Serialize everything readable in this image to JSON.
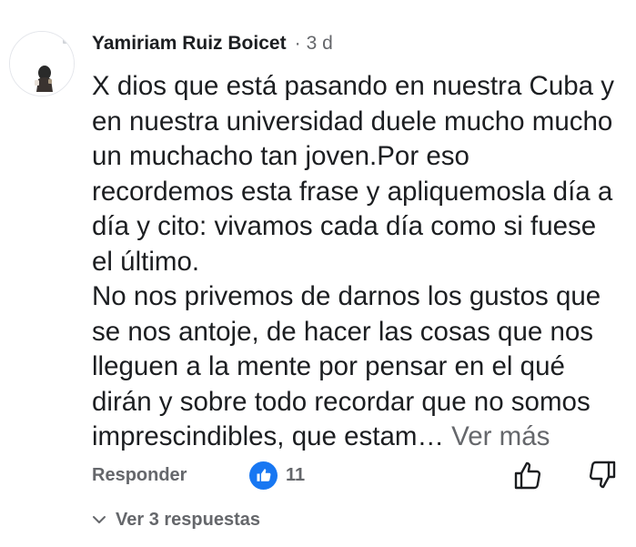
{
  "comment": {
    "author": "Yamiriam Ruiz Boicet",
    "separator": "·",
    "time": "3 d",
    "paragraphs": [
      [
        "X dios que está pasando en nuestra Cuba y",
        "en nuestra universidad duele mucho mucho",
        "un muchacho tan joven.Por eso",
        "recordemos esta frase y apliquemosla día a",
        "día y cito: vivamos cada día como si fuese",
        "el último."
      ],
      [
        "No nos privemos de darnos los gustos que",
        "se nos antoje, de hacer las cosas que nos",
        "lleguen a la mente por pensar en el qué",
        "dirán y sobre todo recordar que no somos"
      ]
    ],
    "truncated_line": "imprescindibles, que estam…",
    "see_more": "Ver más"
  },
  "actions": {
    "reply_label": "Responder",
    "reaction_icon": "like-icon",
    "reaction_count": "11",
    "upvote_icon": "thumbs-up-outline-icon",
    "downvote_icon": "thumbs-down-outline-icon"
  },
  "replies": {
    "icon": "chevron-down-icon",
    "label": "Ver 3 respuestas"
  },
  "colors": {
    "primary_text": "#1c1e21",
    "secondary_text": "#65676b",
    "like_blue": "#1877f2"
  }
}
